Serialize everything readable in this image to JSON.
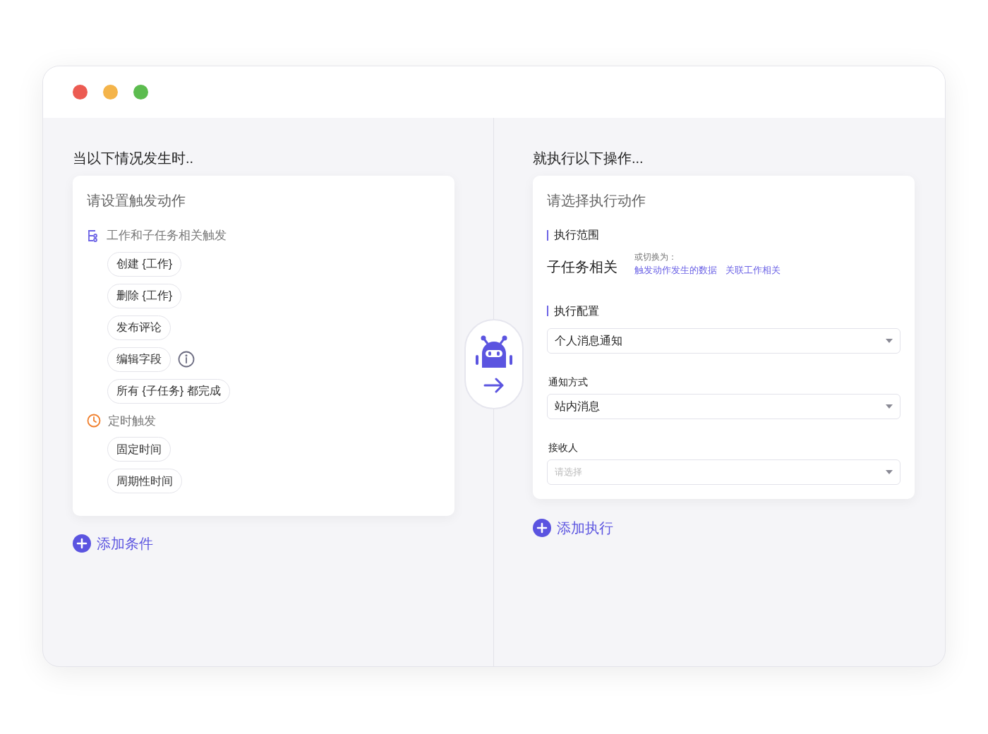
{
  "window": {
    "controls": [
      {
        "color": "#ec5b52"
      },
      {
        "color": "#f4b44a"
      },
      {
        "color": "#5cbc4f"
      }
    ]
  },
  "trigger": {
    "heading": "当以下情况发生时..",
    "card_title": "请设置触发动作",
    "groups": [
      {
        "kind": "tree",
        "label": "工作和子任务相关触发",
        "options": [
          {
            "kind": "chip",
            "label": "创建 {工作}"
          },
          {
            "kind": "chip",
            "label": "删除 {工作}"
          },
          {
            "kind": "chip",
            "label": "发布评论"
          },
          {
            "kind": "chip_info",
            "label": "编辑字段"
          },
          {
            "kind": "chip",
            "label": "所有 {子任务} 都完成"
          }
        ]
      },
      {
        "kind": "clock",
        "label": "定时触发",
        "options": [
          {
            "kind": "chip",
            "label": "固定时间"
          },
          {
            "kind": "chip",
            "label": "周期性时间"
          }
        ]
      }
    ],
    "add_button": "添加条件"
  },
  "action": {
    "heading": "就执行以下操作...",
    "card_title": "请选择执行动作",
    "scope": {
      "label": "执行范围",
      "value": "子任务相关",
      "hint": "或切换为：",
      "links": [
        "触发动作发生的数据",
        "关联工作相关"
      ]
    },
    "config": {
      "label": "执行配置",
      "fields": [
        {
          "value": "个人消息通知"
        },
        {
          "label": "通知方式",
          "value": "站内消息"
        },
        {
          "label": "接收人",
          "placeholder": "请选择"
        }
      ]
    },
    "add_button": "添加执行"
  }
}
